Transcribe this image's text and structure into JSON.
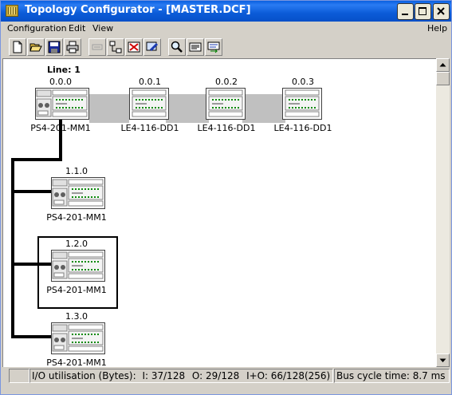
{
  "window": {
    "title": "Topology Configurator - [MASTER.DCF]"
  },
  "menu": {
    "items": [
      "Configuration",
      "Edit",
      "View"
    ],
    "help": "Help"
  },
  "toolbar": {
    "buttons": [
      {
        "icon": "new-file-icon",
        "enabled": true
      },
      {
        "icon": "open-folder-icon",
        "enabled": true
      },
      {
        "icon": "save-icon",
        "enabled": true
      },
      {
        "icon": "print-icon",
        "enabled": true
      },
      {
        "icon": "insert-station-icon",
        "enabled": false
      },
      {
        "icon": "insert-module-icon",
        "enabled": true
      },
      {
        "icon": "delete-icon",
        "enabled": true
      },
      {
        "icon": "edit-parameters-icon",
        "enabled": true
      },
      {
        "icon": "find-icon",
        "enabled": true
      },
      {
        "icon": "show-list-icon",
        "enabled": true
      },
      {
        "icon": "transfer-icon",
        "enabled": true
      }
    ]
  },
  "topology": {
    "line_label": "Line: 1",
    "master_line": [
      {
        "address": "0.0.0",
        "name": "PS4-201-MM1"
      },
      {
        "address": "0.0.1",
        "name": "LE4-116-DD1"
      },
      {
        "address": "0.0.2",
        "name": "LE4-116-DD1"
      },
      {
        "address": "0.0.3",
        "name": "LE4-116-DD1"
      }
    ],
    "slaves": [
      {
        "address": "1.1.0",
        "name": "PS4-201-MM1",
        "selected": false
      },
      {
        "address": "1.2.0",
        "name": "PS4-201-MM1",
        "selected": true
      },
      {
        "address": "1.3.0",
        "name": "PS4-201-MM1",
        "selected": false
      }
    ]
  },
  "status": {
    "io_label": "I/O utilisation (Bytes):",
    "i_value": "I:  37/128",
    "o_value": "O:  29/128",
    "io_value": "I+O:  66/128(256)",
    "bus_cycle": "Bus cycle time:  8.7 ms"
  },
  "colors": {
    "titlebar": "#0a5fe0",
    "bus": "#c0c0c0",
    "face": "#d4d0c8"
  }
}
